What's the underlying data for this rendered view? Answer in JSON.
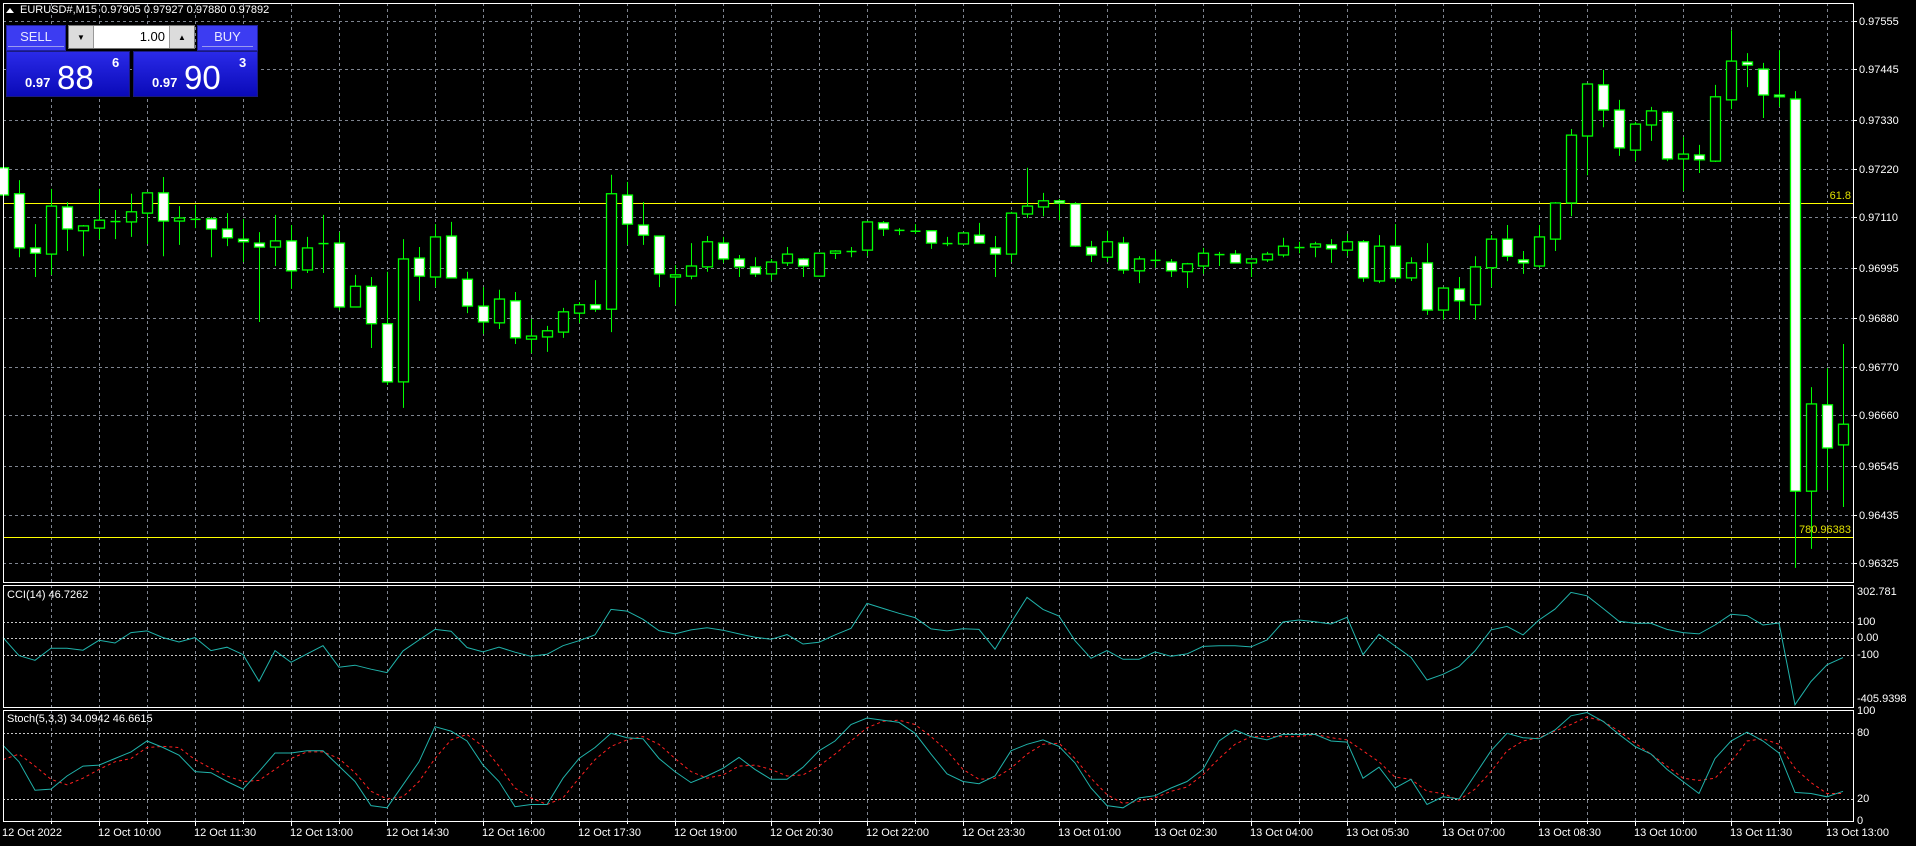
{
  "header": {
    "symbol": "EURUSD#,M15",
    "ohlc": "0.97905 0.97927 0.97880 0.97892"
  },
  "trade_panel": {
    "sell_label": "SELL",
    "buy_label": "BUY",
    "lot_value": "1.00",
    "sell_price": {
      "prefix": "0.97",
      "big": "88",
      "sup": "6"
    },
    "buy_price": {
      "prefix": "0.97",
      "big": "90",
      "sup": "3"
    }
  },
  "price_axis": [
    "0.97555",
    "0.97445",
    "0.97330",
    "0.97220",
    "0.97110",
    "0.96995",
    "0.96880",
    "0.96770",
    "0.96660",
    "0.96545",
    "0.96435",
    "0.96325"
  ],
  "fib_levels": [
    {
      "label": "61.8",
      "price": 0.97142
    },
    {
      "label": "780.96383",
      "price": 0.96383
    }
  ],
  "cci_panel": {
    "label": "CCI(14) 46.7262",
    "axis": [
      "302.781",
      "100",
      "0.00",
      "-100",
      "-405.9398"
    ],
    "max": 302.781,
    "min": -405.9398
  },
  "stoch_panel": {
    "label": "Stoch(5,3,3) 34.0942 46.6615",
    "axis": [
      "100",
      "80",
      "20",
      "0"
    ]
  },
  "time_labels": [
    "12 Oct 2022",
    "12 Oct 10:00",
    "12 Oct 11:30",
    "12 Oct 13:00",
    "12 Oct 14:30",
    "12 Oct 16:00",
    "12 Oct 17:30",
    "12 Oct 19:00",
    "12 Oct 20:30",
    "12 Oct 22:00",
    "12 Oct 23:30",
    "13 Oct 01:00",
    "13 Oct 02:30",
    "13 Oct 04:00",
    "13 Oct 05:30",
    "13 Oct 07:00",
    "13 Oct 08:30",
    "13 Oct 10:00",
    "13 Oct 11:30",
    "13 Oct 13:00"
  ],
  "colors": {
    "candle_outline": "#00ff00",
    "bear_fill": "#ffffff",
    "bull_fill": "#000000",
    "fib": "#ffff00",
    "cci": "#20b2aa",
    "stoch_main": "#20b2aa",
    "stoch_signal": "#ff2020",
    "grid": "#7f8590"
  },
  "chart_data": {
    "type": "candlestick",
    "symbol": "EURUSD#",
    "timeframe": "M15",
    "ylim": [
      0.96325,
      0.97555
    ],
    "candles": [
      [
        0.97222,
        0.97242,
        0.97133,
        0.9716
      ],
      [
        0.97163,
        0.97194,
        0.97019,
        0.9704
      ],
      [
        0.9704,
        0.97094,
        0.96974,
        0.97028
      ],
      [
        0.97026,
        0.97174,
        0.96979,
        0.97135
      ],
      [
        0.97133,
        0.97144,
        0.97033,
        0.97083
      ],
      [
        0.97079,
        0.97092,
        0.97021,
        0.9709
      ],
      [
        0.97085,
        0.97174,
        0.9706,
        0.97103
      ],
      [
        0.97101,
        0.97126,
        0.9706,
        0.97101
      ],
      [
        0.97099,
        0.97163,
        0.97065,
        0.97122
      ],
      [
        0.97119,
        0.97165,
        0.97049,
        0.97165
      ],
      [
        0.97165,
        0.97201,
        0.97021,
        0.97101
      ],
      [
        0.97101,
        0.97135,
        0.97047,
        0.97108
      ],
      [
        0.97106,
        0.97138,
        0.97085,
        0.97106
      ],
      [
        0.97106,
        0.9711,
        0.97019,
        0.97083
      ],
      [
        0.97083,
        0.97119,
        0.97044,
        0.97063
      ],
      [
        0.9706,
        0.97106,
        0.97008,
        0.97054
      ],
      [
        0.97051,
        0.97076,
        0.96872,
        0.97042
      ],
      [
        0.97042,
        0.97115,
        0.96999,
        0.97056
      ],
      [
        0.97056,
        0.97092,
        0.96947,
        0.96988
      ],
      [
        0.9699,
        0.97065,
        0.96983,
        0.9704
      ],
      [
        0.97051,
        0.97115,
        0.96983,
        0.97051
      ],
      [
        0.97051,
        0.97076,
        0.96899,
        0.96906
      ],
      [
        0.96906,
        0.96979,
        0.96906,
        0.96953
      ],
      [
        0.96953,
        0.96974,
        0.96813,
        0.96868
      ],
      [
        0.96868,
        0.96986,
        0.96729,
        0.96736
      ],
      [
        0.96736,
        0.9706,
        0.96677,
        0.97015
      ],
      [
        0.97017,
        0.97042,
        0.9692,
        0.96976
      ],
      [
        0.96974,
        0.97094,
        0.96951,
        0.97065
      ],
      [
        0.97067,
        0.97099,
        0.96972,
        0.96972
      ],
      [
        0.96969,
        0.96986,
        0.96892,
        0.96908
      ],
      [
        0.96908,
        0.96951,
        0.96845,
        0.96872
      ],
      [
        0.9687,
        0.96945,
        0.96856,
        0.96924
      ],
      [
        0.9692,
        0.9694,
        0.96822,
        0.96836
      ],
      [
        0.96833,
        0.96879,
        0.96801,
        0.9684
      ],
      [
        0.96838,
        0.96863,
        0.96804,
        0.96852
      ],
      [
        0.96849,
        0.96904,
        0.96836,
        0.96895
      ],
      [
        0.96892,
        0.96917,
        0.9687,
        0.96911
      ],
      [
        0.96911,
        0.96967,
        0.96895,
        0.96901
      ],
      [
        0.96901,
        0.97206,
        0.96849,
        0.97163
      ],
      [
        0.9716,
        0.9719,
        0.97047,
        0.97094
      ],
      [
        0.97092,
        0.97144,
        0.97047,
        0.97069
      ],
      [
        0.97067,
        0.97067,
        0.96951,
        0.96981
      ],
      [
        0.96974,
        0.97001,
        0.96911,
        0.96979
      ],
      [
        0.96976,
        0.97051,
        0.96969,
        0.96999
      ],
      [
        0.96997,
        0.97067,
        0.96986,
        0.97054
      ],
      [
        0.97051,
        0.97065,
        0.97006,
        0.97015
      ],
      [
        0.97015,
        0.97024,
        0.96974,
        0.96997
      ],
      [
        0.96997,
        0.97019,
        0.96974,
        0.96981
      ],
      [
        0.96981,
        0.97015,
        0.96967,
        0.97008
      ],
      [
        0.97006,
        0.97042,
        0.96999,
        0.97026
      ],
      [
        0.97015,
        0.97017,
        0.96974,
        0.96999
      ],
      [
        0.96976,
        0.97028,
        0.96976,
        0.97028
      ],
      [
        0.97028,
        0.97035,
        0.97015,
        0.97033
      ],
      [
        0.97033,
        0.97042,
        0.97019,
        0.97033
      ],
      [
        0.97035,
        0.97101,
        0.97021,
        0.97099
      ],
      [
        0.97097,
        0.97101,
        0.97067,
        0.97083
      ],
      [
        0.97081,
        0.97085,
        0.97069,
        0.97081
      ],
      [
        0.97079,
        0.97094,
        0.97072,
        0.97079
      ],
      [
        0.97079,
        0.97079,
        0.97038,
        0.97051
      ],
      [
        0.97051,
        0.97065,
        0.97044,
        0.97051
      ],
      [
        0.97049,
        0.97074,
        0.97049,
        0.97074
      ],
      [
        0.97069,
        0.97097,
        0.97051,
        0.97051
      ],
      [
        0.9704,
        0.97067,
        0.96974,
        0.97026
      ],
      [
        0.97026,
        0.97122,
        0.97008,
        0.97119
      ],
      [
        0.97117,
        0.97222,
        0.97108,
        0.97135
      ],
      [
        0.97133,
        0.97165,
        0.97112,
        0.97147
      ],
      [
        0.97147,
        0.97151,
        0.97103,
        0.97142
      ],
      [
        0.9714,
        0.97144,
        0.97042,
        0.97044
      ],
      [
        0.97042,
        0.97056,
        0.97008,
        0.97024
      ],
      [
        0.97019,
        0.97079,
        0.97008,
        0.97054
      ],
      [
        0.97051,
        0.97065,
        0.96981,
        0.9699
      ],
      [
        0.96988,
        0.97021,
        0.9696,
        0.97015
      ],
      [
        0.97013,
        0.97035,
        0.96995,
        0.97013
      ],
      [
        0.97008,
        0.97015,
        0.96974,
        0.96988
      ],
      [
        0.96986,
        0.97006,
        0.96949,
        0.97004
      ],
      [
        0.96999,
        0.9704,
        0.96981,
        0.97028
      ],
      [
        0.97026,
        0.97031,
        0.96999,
        0.97026
      ],
      [
        0.97026,
        0.97035,
        0.97006,
        0.97006
      ],
      [
        0.97006,
        0.97015,
        0.96974,
        0.97015
      ],
      [
        0.97013,
        0.97031,
        0.97008,
        0.97026
      ],
      [
        0.97024,
        0.97063,
        0.97019,
        0.97044
      ],
      [
        0.97042,
        0.97054,
        0.97028,
        0.97042
      ],
      [
        0.97042,
        0.97054,
        0.97019,
        0.97049
      ],
      [
        0.97047,
        0.9706,
        0.97006,
        0.97038
      ],
      [
        0.97035,
        0.97072,
        0.97021,
        0.97054
      ],
      [
        0.97054,
        0.97058,
        0.96963,
        0.96972
      ],
      [
        0.96965,
        0.97069,
        0.9696,
        0.97044
      ],
      [
        0.97044,
        0.97094,
        0.96963,
        0.96972
      ],
      [
        0.96972,
        0.97019,
        0.96965,
        0.97006
      ],
      [
        0.97006,
        0.97051,
        0.96888,
        0.96899
      ],
      [
        0.96899,
        0.96949,
        0.96877,
        0.96949
      ],
      [
        0.96947,
        0.96974,
        0.96877,
        0.9692
      ],
      [
        0.96911,
        0.97021,
        0.96877,
        0.96997
      ],
      [
        0.96995,
        0.97069,
        0.96951,
        0.9706
      ],
      [
        0.9706,
        0.97092,
        0.9701,
        0.97021
      ],
      [
        0.97013,
        0.97033,
        0.96981,
        0.97006
      ],
      [
        0.96999,
        0.97092,
        0.96995,
        0.97065
      ],
      [
        0.9706,
        0.97144,
        0.97033,
        0.97142
      ],
      [
        0.97142,
        0.9731,
        0.97112,
        0.97296
      ],
      [
        0.97294,
        0.97412,
        0.97205,
        0.97412
      ],
      [
        0.9741,
        0.97444,
        0.97314,
        0.97353
      ],
      [
        0.97353,
        0.97376,
        0.97249,
        0.97267
      ],
      [
        0.97262,
        0.97326,
        0.97237,
        0.97321
      ],
      [
        0.97319,
        0.9736,
        0.97283,
        0.97351
      ],
      [
        0.97348,
        0.97351,
        0.97237,
        0.97242
      ],
      [
        0.97242,
        0.97292,
        0.97169,
        0.97253
      ],
      [
        0.97251,
        0.97274,
        0.9721,
        0.9724
      ],
      [
        0.97237,
        0.9741,
        0.97235,
        0.97383
      ],
      [
        0.97376,
        0.97534,
        0.97355,
        0.97464
      ],
      [
        0.97462,
        0.97482,
        0.97405,
        0.97455
      ],
      [
        0.97446,
        0.9746,
        0.97335,
        0.97387
      ],
      [
        0.97387,
        0.97489,
        0.9736,
        0.97383
      ],
      [
        0.97378,
        0.97396,
        0.96314,
        0.96488
      ],
      [
        0.96488,
        0.96724,
        0.96357,
        0.96686
      ],
      [
        0.96684,
        0.96767,
        0.96491,
        0.96586
      ],
      [
        0.96593,
        0.96822,
        0.96452,
        0.9664
      ]
    ],
    "cci": [
      4,
      -103,
      -131,
      -59,
      -59,
      -71,
      -12,
      -28,
      34,
      44,
      4,
      -22,
      4,
      -73,
      -53,
      -97,
      -256,
      -73,
      -143,
      -93,
      -44,
      -172,
      -160,
      -184,
      -204,
      -75,
      -10,
      53,
      42,
      -55,
      -81,
      -53,
      -83,
      -107,
      -95,
      -44,
      -14,
      20,
      172,
      162,
      113,
      46,
      26,
      50,
      63,
      48,
      26,
      6,
      -6,
      22,
      -34,
      -24,
      20,
      59,
      208,
      178,
      149,
      123,
      56,
      44,
      57,
      53,
      -65,
      93,
      244,
      172,
      133,
      -14,
      -119,
      -73,
      -125,
      -125,
      -81,
      -107,
      -93,
      -48,
      -44,
      -44,
      -51,
      -10,
      97,
      109,
      99,
      85,
      125,
      -97,
      24,
      -46,
      -113,
      -248,
      -214,
      -168,
      -75,
      50,
      71,
      20,
      109,
      174,
      273,
      253,
      178,
      101,
      89,
      89,
      53,
      34,
      26,
      79,
      143,
      135,
      79,
      91,
      -395,
      -257,
      -158,
      -115
    ],
    "stoch_main": [
      69,
      54,
      28,
      29,
      41,
      50,
      51,
      57,
      63,
      73,
      67,
      60,
      45,
      44,
      36,
      29,
      45,
      62,
      62,
      64,
      64,
      50,
      36,
      14,
      12,
      33,
      54,
      86,
      82,
      73,
      51,
      36,
      13,
      15,
      15,
      39,
      57,
      67,
      80,
      76,
      75,
      57,
      45,
      35,
      41,
      48,
      58,
      47,
      38,
      38,
      49,
      64,
      73,
      88,
      94,
      92,
      90,
      80,
      61,
      43,
      36,
      34,
      41,
      64,
      70,
      74,
      68,
      53,
      30,
      14,
      12,
      21,
      23,
      30,
      36,
      47,
      73,
      83,
      77,
      74,
      79,
      79,
      79,
      73,
      72,
      39,
      49,
      30,
      38,
      15,
      22,
      20,
      42,
      64,
      80,
      76,
      75,
      83,
      96,
      99,
      91,
      79,
      68,
      61,
      47,
      36,
      25,
      57,
      73,
      81,
      73,
      62,
      26,
      25,
      22,
      27
    ],
    "stoch_signal": [
      56,
      61,
      50,
      38,
      33,
      39,
      47,
      54,
      57,
      67,
      68,
      67,
      56,
      48,
      41,
      36,
      37,
      47,
      57,
      63,
      63,
      57,
      44,
      27,
      20,
      22,
      36,
      57,
      74,
      79,
      68,
      50,
      30,
      21,
      15,
      21,
      39,
      56,
      68,
      74,
      77,
      70,
      57,
      45,
      39,
      42,
      50,
      51,
      47,
      41,
      42,
      50,
      61,
      73,
      85,
      91,
      92,
      88,
      77,
      64,
      47,
      38,
      39,
      48,
      61,
      70,
      71,
      57,
      39,
      24,
      16,
      18,
      21,
      27,
      31,
      42,
      57,
      70,
      77,
      77,
      77,
      77,
      79,
      76,
      74,
      64,
      54,
      40,
      38,
      27,
      25,
      19,
      29,
      45,
      64,
      73,
      76,
      82,
      88,
      95,
      91,
      82,
      71,
      61,
      50,
      39,
      37,
      39,
      54,
      73,
      75,
      70,
      48,
      35,
      25,
      25
    ]
  }
}
